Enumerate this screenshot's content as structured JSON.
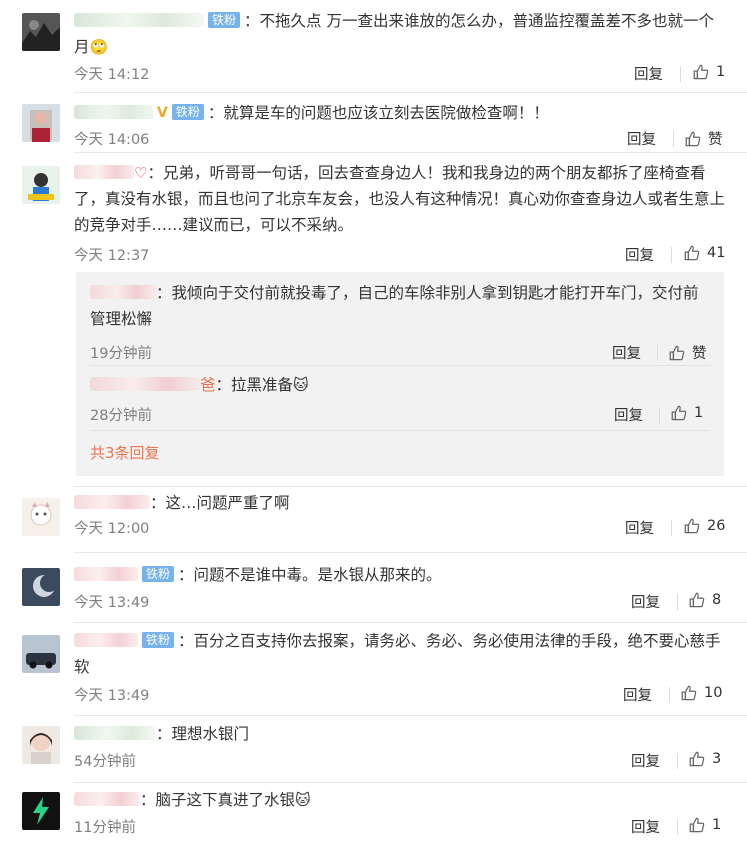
{
  "ui": {
    "reply_label": "回复",
    "fan_badge": "铁粉",
    "like_label": "赞",
    "accent_link": "#eb7350",
    "badge_color": "#76b2eb"
  },
  "comments": [
    {
      "text": "：不拖久点 万一查出来谁放的怎么办，普通监控覆盖差不多也就一个月",
      "emoji": "🙄",
      "time": "今天 14:12",
      "likes": "1"
    },
    {
      "text": "：就算是车的问题也应该立刻去医院做检查啊！！",
      "time": "今天 14:06",
      "likes": "赞"
    },
    {
      "text": "：兄弟，听哥哥一句话，回去查查身边人！我和我身边的两个朋友都拆了座椅查看了，真没有水银，而且也问了北京车友会，也没人有这种情况！真心劝你查查身边人或者生意上的竞争对手……建议而已，可以不采纳。",
      "time": "今天 12:37",
      "likes": "41",
      "subs": [
        {
          "text": "：我倾向于交付前就投毒了，自己的车除非别人拿到钥匙才能打开车门，交付前管理松懈",
          "time": "19分钟前",
          "likes": "赞"
        },
        {
          "suffix": "爸",
          "text": "：拉黑准备",
          "emoji": "🐱",
          "time": "28分钟前",
          "likes": "1"
        }
      ],
      "total": "共3条回复"
    },
    {
      "text": "：这…问题严重了啊",
      "time": "今天 12:00",
      "likes": "26"
    },
    {
      "text": "：问题不是谁中毒。是水银从那来的。",
      "time": "今天 13:49",
      "likes": "8"
    },
    {
      "text": "：百分之百支持你去报案，请务必、务必、务必使用法律的手段，绝不要心慈手软",
      "time": "今天 13:49",
      "likes": "10"
    },
    {
      "text": "：理想水银门",
      "time": "54分钟前",
      "likes": "3"
    },
    {
      "text": "：脑子这下真进了水银",
      "emoji": "🐱",
      "time": "11分钟前",
      "likes": "1"
    }
  ]
}
